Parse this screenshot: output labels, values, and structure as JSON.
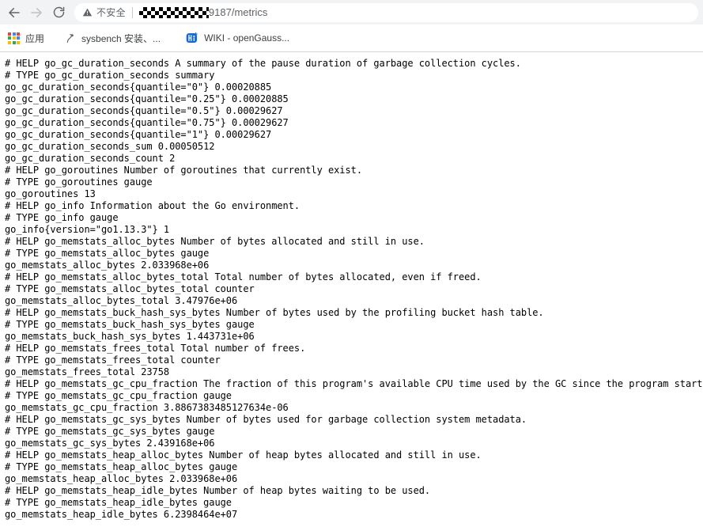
{
  "browser": {
    "nav": {
      "back_icon": "arrow-left-icon",
      "forward_icon": "arrow-right-icon",
      "reload_icon": "reload-icon",
      "back_enabled": true,
      "forward_enabled": false
    },
    "omnibox": {
      "security_icon": "warning-triangle-icon",
      "security_label": "不安全",
      "url_redacted": true,
      "url_visible_text": "9187/metrics"
    },
    "bookmarks": [
      {
        "label": "应用",
        "icon": "apps-grid-icon"
      },
      {
        "label": "sysbench 安装、...",
        "icon": "sysbench-favicon"
      },
      {
        "label": "WIKI - openGauss...",
        "icon": "wiki-favicon"
      }
    ],
    "colors": {
      "toolbar_bg": "#f1f3f4",
      "text_muted": "#5f6368",
      "text_dark": "#3c4043",
      "separator": "#d3d5d8",
      "apps_red": "#ea4335",
      "apps_blue": "#4285f4",
      "apps_green": "#34a853",
      "apps_yellow": "#fbbc05",
      "wiki_blue": "#1868db"
    }
  },
  "page": {
    "content_type": "prometheus-metrics-plaintext",
    "body": "# HELP go_gc_duration_seconds A summary of the pause duration of garbage collection cycles.\n# TYPE go_gc_duration_seconds summary\ngo_gc_duration_seconds{quantile=\"0\"} 0.00020885\ngo_gc_duration_seconds{quantile=\"0.25\"} 0.00020885\ngo_gc_duration_seconds{quantile=\"0.5\"} 0.00029627\ngo_gc_duration_seconds{quantile=\"0.75\"} 0.00029627\ngo_gc_duration_seconds{quantile=\"1\"} 0.00029627\ngo_gc_duration_seconds_sum 0.00050512\ngo_gc_duration_seconds_count 2\n# HELP go_goroutines Number of goroutines that currently exist.\n# TYPE go_goroutines gauge\ngo_goroutines 13\n# HELP go_info Information about the Go environment.\n# TYPE go_info gauge\ngo_info{version=\"go1.13.3\"} 1\n# HELP go_memstats_alloc_bytes Number of bytes allocated and still in use.\n# TYPE go_memstats_alloc_bytes gauge\ngo_memstats_alloc_bytes 2.033968e+06\n# HELP go_memstats_alloc_bytes_total Total number of bytes allocated, even if freed.\n# TYPE go_memstats_alloc_bytes_total counter\ngo_memstats_alloc_bytes_total 3.47976e+06\n# HELP go_memstats_buck_hash_sys_bytes Number of bytes used by the profiling bucket hash table.\n# TYPE go_memstats_buck_hash_sys_bytes gauge\ngo_memstats_buck_hash_sys_bytes 1.443731e+06\n# HELP go_memstats_frees_total Total number of frees.\n# TYPE go_memstats_frees_total counter\ngo_memstats_frees_total 23758\n# HELP go_memstats_gc_cpu_fraction The fraction of this program's available CPU time used by the GC since the program started.\n# TYPE go_memstats_gc_cpu_fraction gauge\ngo_memstats_gc_cpu_fraction 3.8867383485127634e-06\n# HELP go_memstats_gc_sys_bytes Number of bytes used for garbage collection system metadata.\n# TYPE go_memstats_gc_sys_bytes gauge\ngo_memstats_gc_sys_bytes 2.439168e+06\n# HELP go_memstats_heap_alloc_bytes Number of heap bytes allocated and still in use.\n# TYPE go_memstats_heap_alloc_bytes gauge\ngo_memstats_heap_alloc_bytes 2.033968e+06\n# HELP go_memstats_heap_idle_bytes Number of heap bytes waiting to be used.\n# TYPE go_memstats_heap_idle_bytes gauge\ngo_memstats_heap_idle_bytes 6.2398464e+07"
  }
}
